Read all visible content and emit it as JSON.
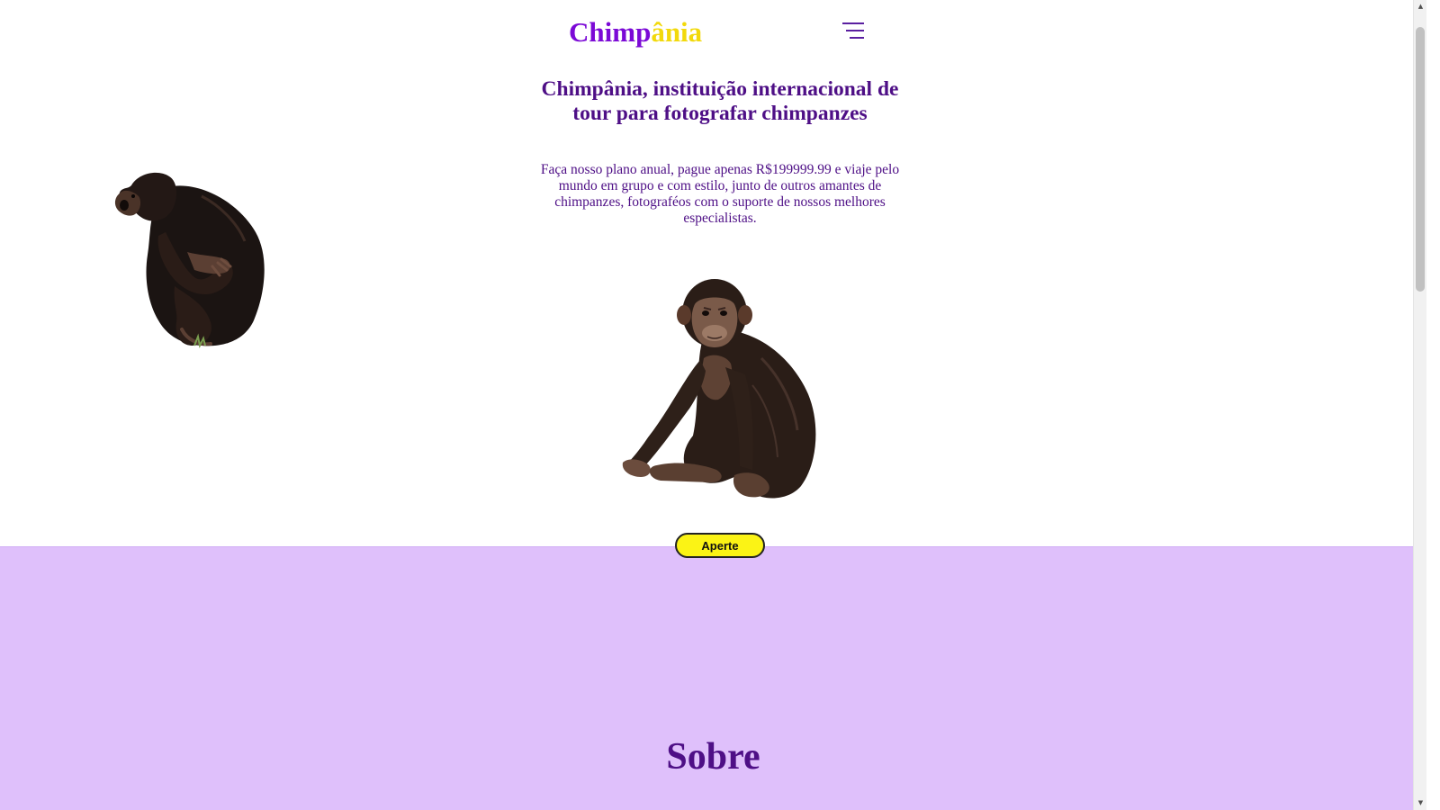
{
  "header": {
    "logo_part1": "Chimp",
    "logo_part2": "ânia",
    "menu_icon": "hamburger-menu-icon"
  },
  "hero": {
    "title": "Chimpânia, instituição internacional de tour para fotografar chimpanzes",
    "description": "Faça nosso plano anual, pague apenas R$199999.99 e viaje pelo mundo em grupo e com estilo, junto de outros amantes de chimpanzes, fotograféos com o suporte de nossos melhores especialistas.",
    "cta_label": "Aperte"
  },
  "about": {
    "title": "Sobre"
  },
  "colors": {
    "brand_purple": "#7b09d6",
    "brand_yellow": "#f2d90b",
    "text_purple": "#4e0f86",
    "section_lavender": "#dfc0fb",
    "button_yellow": "#fbf315"
  }
}
